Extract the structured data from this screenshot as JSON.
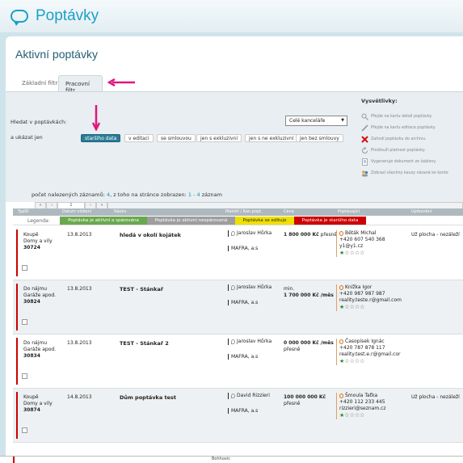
{
  "app": {
    "title": "Poptávky"
  },
  "page": {
    "title": "Aktivní poptávky"
  },
  "tabs": [
    {
      "label": "Základní filtr"
    },
    {
      "label": "Pracovní filtr"
    }
  ],
  "filter": {
    "search_in_label": "Hledat v poptávkách:",
    "show_only_label": "a ukázat jen",
    "office_select": "Celé kanceláře",
    "chips": [
      "staršího data",
      "v editaci",
      "se smlouvou",
      "jen s exkluzivní",
      "jen s ne exkluzivní",
      "jen bez smlouvy"
    ]
  },
  "explanations": {
    "title": "Vysvětlivky:",
    "items": [
      {
        "icon": "magnifier-icon",
        "text": "Přejde na kartu detail poptávky."
      },
      {
        "icon": "pencil-icon",
        "text": "Přejde na kartu editace poptávky."
      },
      {
        "icon": "delete-x-icon",
        "text": "Zahodí poptávku do archivu."
      },
      {
        "icon": "refresh-icon",
        "text": "Prodlouží platnost poptávky."
      },
      {
        "icon": "document-icon",
        "text": "Vygeneruje dokument ze šablony."
      },
      {
        "icon": "people-icon",
        "text": "Zobrazí všechny kauzy vázané ke konte"
      }
    ]
  },
  "count": {
    "prefix": "počet nalezených záznamů:",
    "total": "4",
    "mid": ", z toho na stránce zobrazen:",
    "range": "1 - 4",
    "suffix": "záznam"
  },
  "pager": {
    "page": "1"
  },
  "table": {
    "headers": [
      "TypID",
      "Datum vložení",
      "Název",
      "Makléř / Kan.popt.",
      "Cena",
      "Poptávající",
      "Upřesnění"
    ]
  },
  "legend": {
    "label": "Legenda:",
    "items": [
      {
        "text": "Poptávka je aktivní a spárována",
        "bg": "#6aa84f",
        "fg": "#ffffff"
      },
      {
        "text": "Poptávka je aktivní nespárovaná",
        "bg": "#9e9e9e",
        "fg": "#ffffff"
      },
      {
        "text": "Poptávka se edituje",
        "bg": "#f0e000",
        "fg": "#222222"
      },
      {
        "text": "Poptávka je staršího data",
        "bg": "#cc0000",
        "fg": "#ffffff"
      }
    ]
  },
  "rows": [
    {
      "type1": "Koupě",
      "type2": "Domy a vily",
      "id": "30724",
      "date": "13.8.2013",
      "name": "hledá v okolí kojátek",
      "agent": "Jaroslav Hůrka",
      "office": "MAFRA, a.s",
      "price1": "",
      "price2": "1 800 000 Kč",
      "price3": "přesně",
      "c_name": "Běták Michal",
      "c_phone": "+420 607 540 368",
      "c_email": "y1@y1.cz",
      "rating": "★☆☆☆☆",
      "extra": "Už plocha - nezáleží"
    },
    {
      "type1": "Do nájmu",
      "type2": "Garáže apod.",
      "id": "30824",
      "date": "13.8.2013",
      "name": "TEST - Stánkař",
      "agent": "Jaroslav Hůrka",
      "office": "MAFRA, a.s",
      "price1": "min.",
      "price2": "1 700 000 Kč /měs",
      "price3": "",
      "c_name": "Knížka Igor",
      "c_phone": "+420 987 987 987",
      "c_email": "reality.teste.r@gmail.com",
      "rating": "★☆☆☆☆",
      "extra": ""
    },
    {
      "type1": "Do nájmu",
      "type2": "Garáže apod.",
      "id": "30834",
      "date": "13.8.2013",
      "name": "TEST - Stánkař 2",
      "agent": "Jaroslav Hůrka",
      "office": "MAFRA, a.s",
      "price1": "",
      "price2": "0 000 000 Kč /měs",
      "price3": "přesně",
      "c_name": "Časopisek Ignác",
      "c_phone": "+420 787 878 117",
      "c_email": "reality.test.e.r@gmail.cor",
      "rating": "★☆☆☆☆",
      "extra": ""
    },
    {
      "type1": "Koupě",
      "type2": "Domy a vily",
      "id": "30874",
      "date": "14.8.2013",
      "name": "Dům poptávka test",
      "agent": "David Rizzieri",
      "office": "MAFRA, a.s",
      "price1": "",
      "price2": "100 000 000 Kč",
      "price3": "přesně",
      "c_name": "Šmoula Taťka",
      "c_phone": "+420 112 233 445",
      "c_email": "rizzieri@seznam.cz",
      "rating": "★☆☆☆☆",
      "extra": "Už plocha - nezáleží"
    }
  ],
  "footer": {
    "text": "Bohhovic"
  }
}
